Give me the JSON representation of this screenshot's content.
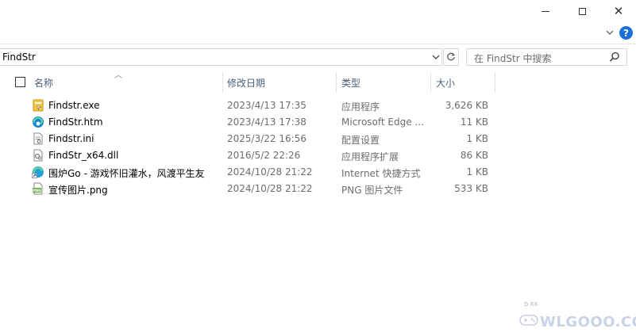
{
  "window": {
    "minimize_label": "",
    "maximize_label": "",
    "close_label": "✕"
  },
  "ribbon": {
    "help_label": "?"
  },
  "address": {
    "path": "FindStr"
  },
  "search": {
    "placeholder": "在 FindStr 中搜索"
  },
  "columns": {
    "name": "名称",
    "date": "修改日期",
    "type": "类型",
    "size": "大小"
  },
  "files": [
    {
      "name": "Findstr.exe",
      "date": "2023/4/13 17:35",
      "type": "应用程序",
      "size": "3,626 KB",
      "icon": "exe-icon"
    },
    {
      "name": "FindStr.htm",
      "date": "2023/4/13 17:38",
      "type": "Microsoft Edge ...",
      "size": "11 KB",
      "icon": "edge-icon"
    },
    {
      "name": "Findstr.ini",
      "date": "2025/3/22 16:56",
      "type": "配置设置",
      "size": "1 KB",
      "icon": "ini-icon"
    },
    {
      "name": "FindStr_x64.dll",
      "date": "2016/5/2 22:26",
      "type": "应用程序扩展",
      "size": "86 KB",
      "icon": "dll-icon"
    },
    {
      "name": "围炉Go - 游戏怀旧灌水，风渡平生友",
      "date": "2024/10/28 21:22",
      "type": "Internet 快捷方式",
      "size": "1 KB",
      "icon": "shortcut-icon"
    },
    {
      "name": "宣传图片.png",
      "date": "2024/10/28 21:22",
      "type": "PNG 图片文件",
      "size": "533 KB",
      "icon": "png-icon"
    }
  ],
  "watermark": {
    "text": "WLGOOO.COM",
    "small": "G XX"
  },
  "colors": {
    "header_text": "#4c607a",
    "help_blue": "#1a6fd6",
    "border": "#d9d9d9"
  }
}
